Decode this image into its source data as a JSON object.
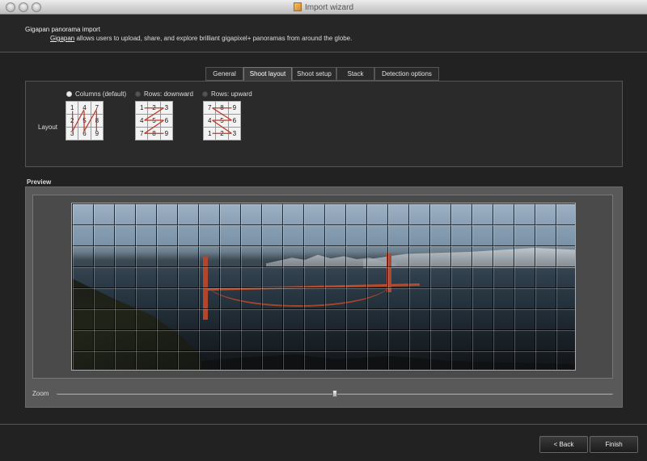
{
  "window": {
    "title": "Import wizard"
  },
  "header": {
    "title": "Gigapan panorama import",
    "link": "Gigapan",
    "description": " allows users to upload, share, and explore brilliant gigapixel+ panoramas from around the globe."
  },
  "tabs": [
    {
      "label": "General"
    },
    {
      "label": "Shoot layout",
      "active": true
    },
    {
      "label": "Shoot setup"
    },
    {
      "label": "Stack"
    },
    {
      "label": "Detection options"
    }
  ],
  "layout": {
    "label": "Layout",
    "options": [
      {
        "label": "Columns (default)",
        "selected": true,
        "cells": [
          "1",
          "4",
          "7",
          "2",
          "5",
          "8",
          "3",
          "6",
          "9"
        ]
      },
      {
        "label": "Rows: downward",
        "selected": false,
        "cells": [
          "1",
          "2",
          "3",
          "4",
          "5",
          "6",
          "7",
          "8",
          "9"
        ]
      },
      {
        "label": "Rows: upward",
        "selected": false,
        "cells": [
          "7",
          "8",
          "9",
          "4",
          "5",
          "6",
          "1",
          "2",
          "3"
        ]
      }
    ]
  },
  "preview": {
    "label": "Preview"
  },
  "zoom": {
    "label": "Zoom",
    "value_fraction": 0.5
  },
  "buttons": {
    "back": "< Back",
    "finish": "Finish"
  },
  "colors": {
    "background": "#222222",
    "panel": "#2a2a2a",
    "preview_bg": "#595959",
    "arrow": "#c0392b"
  }
}
